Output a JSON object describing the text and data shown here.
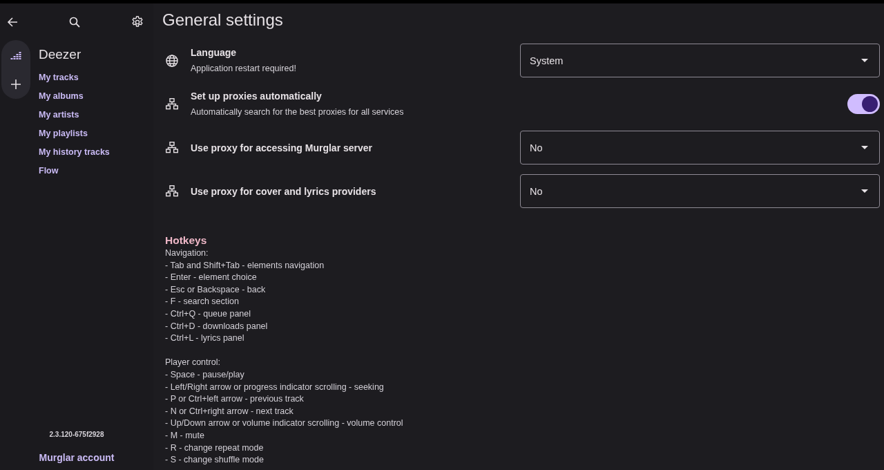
{
  "sidebar": {
    "source_title": "Deezer",
    "links": [
      "My tracks",
      "My albums",
      "My artists",
      "My playlists",
      "My history tracks",
      "Flow"
    ],
    "version": "2.3.120-675f2928",
    "account_link": "Murglar account"
  },
  "page": {
    "title": "General settings"
  },
  "settings": [
    {
      "kind": "language",
      "title": "Language",
      "subtitle": "Application restart required!",
      "control": {
        "kind": "select",
        "value": "System"
      }
    },
    {
      "kind": "proxy",
      "title": "Set up proxies automatically",
      "subtitle": "Automatically search for the best proxies for all services",
      "control": {
        "kind": "switch",
        "on": true
      }
    },
    {
      "kind": "proxy",
      "title": "Use proxy for accessing Murglar server",
      "control": {
        "kind": "select",
        "value": "No"
      }
    },
    {
      "kind": "proxy",
      "title": "Use proxy for cover and lyrics providers",
      "control": {
        "kind": "select",
        "value": "No"
      }
    }
  ],
  "hotkeys": {
    "title": "Hotkeys",
    "sections": [
      {
        "heading": "Navigation:",
        "lines": [
          "- Tab and Shift+Tab - elements navigation",
          "- Enter - element choice",
          "- Esc or Backspace - back",
          "- F - search section",
          "- Ctrl+Q - queue panel",
          "- Ctrl+D - downloads panel",
          "- Ctrl+L - lyrics panel"
        ]
      },
      {
        "heading": "Player control:",
        "lines": [
          "- Space - pause/play",
          "- Left/Right arrow or progress indicator scrolling - seeking",
          "- P or Ctrl+left arrow - previous track",
          "- N or Ctrl+right arrow - next track",
          "- Up/Down arrow or volume indicator scrolling - volume control",
          "- M - mute",
          "- R - change repeat mode",
          "- S - change shuffle mode"
        ]
      }
    ]
  }
}
